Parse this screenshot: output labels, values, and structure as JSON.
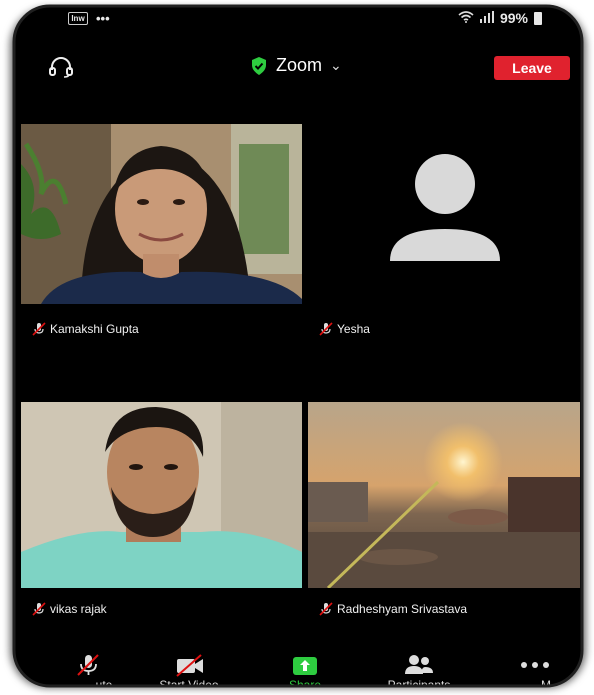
{
  "status_bar": {
    "left_text": "•••",
    "right_text": "99%",
    "box_label": "Inw"
  },
  "header": {
    "title": "Zoom",
    "leave_label": "Leave"
  },
  "participants": [
    {
      "name": "Kamakshi Gupta",
      "muted": true,
      "video": true
    },
    {
      "name": "Yesha",
      "muted": true,
      "video": false
    },
    {
      "name": "vikas rajak",
      "muted": true,
      "video": true
    },
    {
      "name": "Radheshyam Srivastava",
      "muted": true,
      "video": true
    }
  ],
  "toolbar": {
    "mute_label": "ute",
    "video_label": "Start Video",
    "share_label": "Share",
    "participants_label": "Participants",
    "more_label": "M"
  },
  "colors": {
    "leave": "#e0222e",
    "share": "#2ecc40",
    "shield": "#2ecc40",
    "mute_slash": "#d11"
  },
  "icons": [
    "headset-icon",
    "shield-icon",
    "chevron-down-icon",
    "mic-off-icon",
    "video-off-icon",
    "share-icon",
    "participants-icon",
    "more-icon"
  ]
}
